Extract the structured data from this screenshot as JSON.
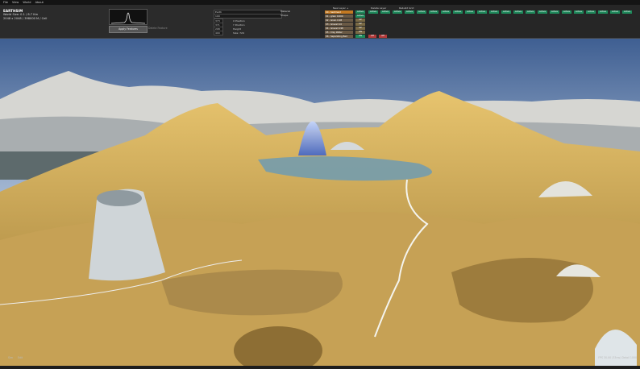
{
  "menu": [
    "File",
    "View",
    "World",
    "About"
  ],
  "world": {
    "title": "EARTHSIM",
    "size_line": "World Size: 0.1 / 8.7 Km",
    "res_line": "2048 x 2048 / 398000 M / Cell"
  },
  "generator": {
    "apply_label": "Apply Features",
    "delete_label": "Delete Feature",
    "type_value": "Earth",
    "type_option": "Material",
    "shape_value": "100",
    "shape_option": "Shape",
    "params": [
      {
        "value": "373",
        "label": "X Position"
      },
      {
        "value": "371",
        "label": "Y Position"
      },
      {
        "value": "208",
        "label": "Height"
      },
      {
        "value": "400",
        "label": "Size: 729"
      }
    ]
  },
  "layers": {
    "header_new": "New Layer +",
    "header_delete": "Delete Layer",
    "header_rebuild": "Rebuild Grid",
    "items": [
      "00 - Sediment",
      "01 - grain 0.000",
      "02 - Grain 0.98",
      "03 - Gravel 0.0",
      "04 - Gravel 0.98",
      "05 - Clay Water",
      "06 - Separating Bed"
    ],
    "action_label": "Active",
    "up_label": "UP",
    "on_label": "ON",
    "off_label": "Off"
  },
  "status": {
    "bottom_left_a": "Sim",
    "bottom_left_b": "Edit",
    "fps": "FPS 30.00 (33ms) Detail 1000"
  },
  "colors": {
    "sand": "#c9a24e",
    "sky": "#8fa8c8",
    "water": "#7fa6b8",
    "layer_active": "#c47a22",
    "chip_green": "#1f8a5c",
    "chip_red": "#b23a3a"
  }
}
